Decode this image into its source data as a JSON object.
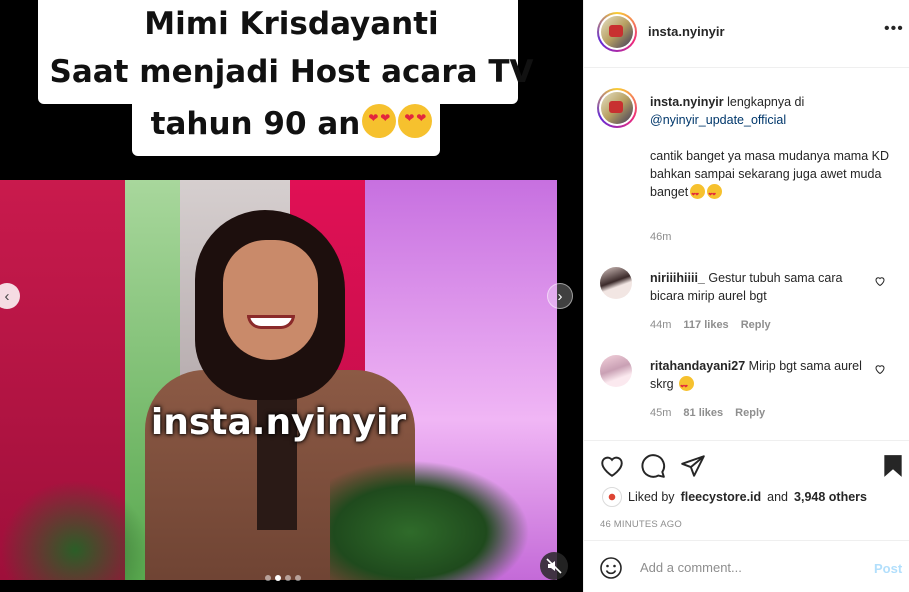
{
  "media": {
    "caption_lines": [
      "Mimi Krisdayanti",
      "Saat menjadi Host acara TV",
      "tahun 90 an"
    ],
    "watermark": "insta.nyinyir",
    "carousel": {
      "total_slides": 4,
      "active_slide": 2
    },
    "prev_glyph": "‹",
    "next_glyph": "›"
  },
  "header": {
    "username": "insta.nyinyir",
    "more_glyph": "•••"
  },
  "caption": {
    "username": "insta.nyinyir",
    "intro": "lengkapnya di",
    "mention": "@nyinyir_update_official",
    "body": "cantik banget ya masa mudanya mama KD\nbahkan sampai sekarang juga awet muda banget",
    "time": "46m"
  },
  "comments": [
    {
      "username": "niriiihiiii_",
      "text": "Gestur tubuh sama cara bicara mirip aurel bgt",
      "time": "44m",
      "likes": "117 likes",
      "reply": "Reply"
    },
    {
      "username": "ritahandayani27",
      "text": "Mirip bgt sama aurel skrg",
      "time": "45m",
      "likes": "81 likes",
      "reply": "Reply"
    }
  ],
  "actions": {
    "liked_by_prefix": "Liked by",
    "liked_by_user": "fleecystore.id",
    "liked_by_and": "and",
    "liked_by_others": "3,948 others",
    "post_age": "46 MINUTES AGO"
  },
  "add_comment": {
    "placeholder": "Add a comment...",
    "post_label": "Post"
  },
  "colors": {
    "link": "#00376b",
    "muted": "#8e8e8e",
    "post_disabled": "#b2dffc"
  }
}
